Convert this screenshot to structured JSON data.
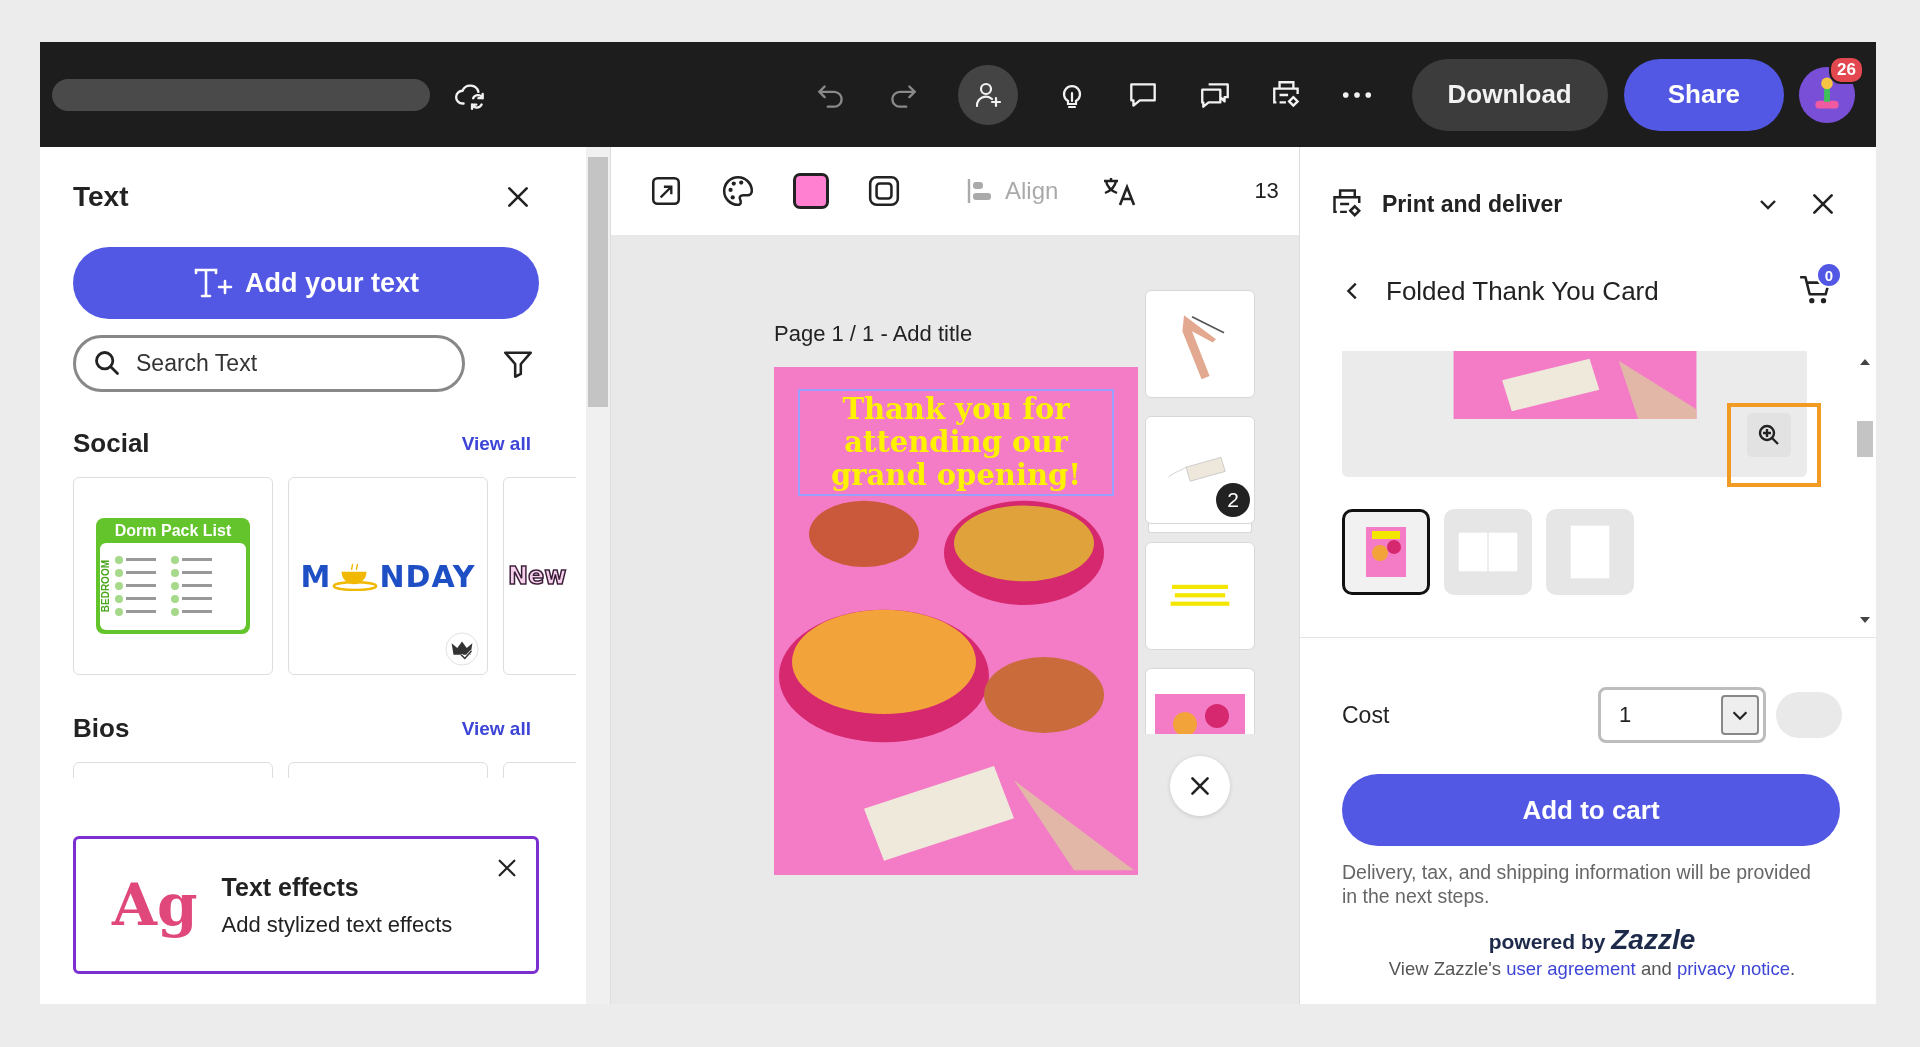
{
  "top_bar": {
    "download_label": "Download",
    "share_label": "Share",
    "notification_count": "26"
  },
  "toolbar": {
    "align": {
      "label": "Align",
      "disabled": true
    },
    "zoom": "13"
  },
  "left_panel": {
    "title": "Text",
    "add_button": "Add your text",
    "search": {
      "placeholder": "Search Text"
    },
    "sections": [
      {
        "title": "Social",
        "link": "View all",
        "cards": [
          {
            "kind": "dorm",
            "title": "Dorm Pack List",
            "side_label": "BEDROOM",
            "premium": false
          },
          {
            "kind": "monday",
            "parts": [
              "M",
              "NDAY"
            ],
            "premium": true
          },
          {
            "kind": "new",
            "text": "New"
          }
        ]
      },
      {
        "title": "Bios",
        "link": "View all",
        "cards": [
          {
            "kind": "blank"
          },
          {
            "kind": "blank"
          },
          {
            "kind": "blank"
          }
        ]
      }
    ],
    "promo": {
      "art": "Ag",
      "title": "Text effects",
      "text": "Add stylized text effects"
    }
  },
  "canvas": {
    "page_label": "Page 1 / 1 - Add title",
    "headline": "Thank you for attending our grand opening!",
    "side_thumbnails": [
      {
        "kind": "hand"
      },
      {
        "kind": "tag",
        "count": "2"
      },
      {
        "kind": "text"
      },
      {
        "kind": "photo"
      }
    ]
  },
  "right_panel": {
    "title": "Print and deliver",
    "product": "Folded Thank You Card",
    "cart_count": "0",
    "zoom_highlighted": true,
    "views": [
      {
        "kind": "front",
        "selected": true
      },
      {
        "kind": "open",
        "selected": false
      },
      {
        "kind": "back",
        "selected": false
      }
    ],
    "cost_label": "Cost",
    "quantity": "1",
    "add_button": "Add to cart",
    "note": "Delivery, tax, and shipping information will be provided in the next steps.",
    "powered_prefix": "powered by",
    "brand": "Zazzle",
    "legal": {
      "before": "View Zazzle's",
      "link1": "user agreement",
      "middle": "and",
      "link2": "privacy notice",
      "after": "."
    }
  }
}
